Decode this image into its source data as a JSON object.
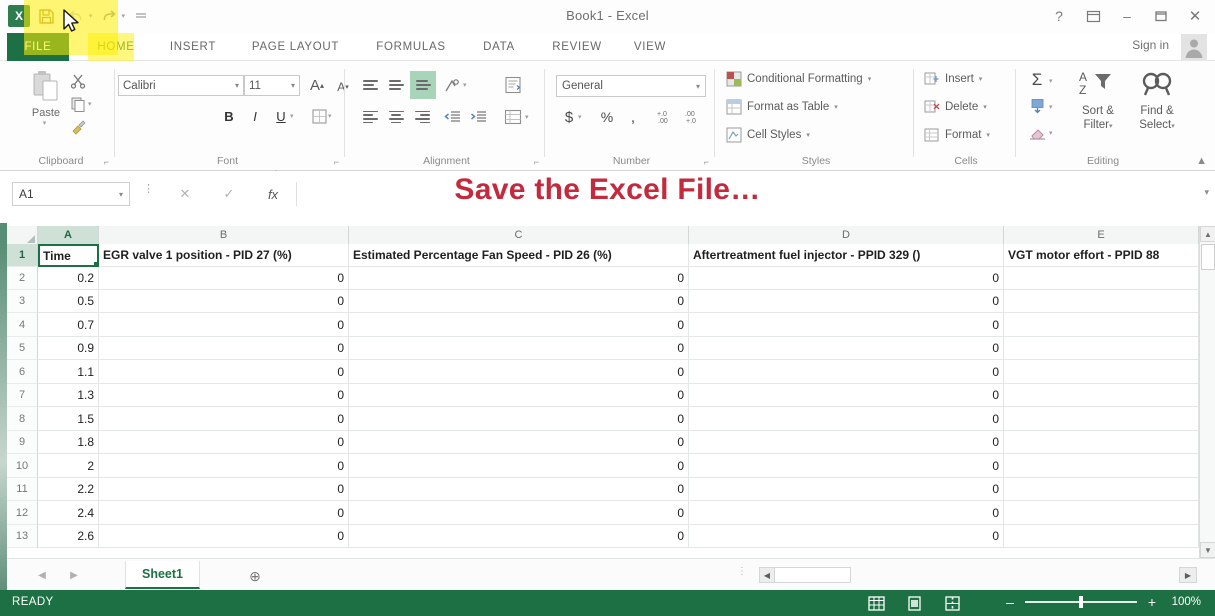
{
  "window": {
    "title": "Book1 - Excel",
    "sign_in": "Sign in",
    "buttons": {
      "help": "?",
      "ribbon_options": "ribbon-display-options",
      "minimize": "–",
      "maximize": "▢",
      "close": "✕"
    }
  },
  "quick_access": {
    "logo": "excel-logo",
    "items": [
      {
        "name": "save",
        "glyph": "save-icon"
      },
      {
        "name": "undo",
        "glyph": "undo-icon"
      },
      {
        "name": "redo",
        "glyph": "redo-icon"
      },
      {
        "name": "customize",
        "glyph": "customize-icon"
      }
    ]
  },
  "ribbon": {
    "tabs": [
      {
        "label": "FILE",
        "active": false
      },
      {
        "label": "HOME",
        "active": true
      },
      {
        "label": "INSERT",
        "active": false
      },
      {
        "label": "PAGE LAYOUT",
        "active": false
      },
      {
        "label": "FORMULAS",
        "active": false
      },
      {
        "label": "DATA",
        "active": false
      },
      {
        "label": "REVIEW",
        "active": false
      },
      {
        "label": "VIEW",
        "active": false
      }
    ],
    "collapse_glyph": "▲",
    "groups": {
      "clipboard": {
        "label": "Clipboard",
        "paste_label": "Paste",
        "cut": "cut-icon",
        "copy": "copy-icon",
        "format_painter": "format-painter-icon"
      },
      "font": {
        "label": "Font",
        "font_name": "Calibri",
        "font_size": "11",
        "grow_font": "A",
        "shrink_font": "A",
        "bold": "B",
        "italic": "I",
        "underline": "U",
        "borders": "borders-icon",
        "fill_color": "fill-color-icon",
        "font_color": "font-color-icon"
      },
      "alignment": {
        "label": "Alignment",
        "top_align": "top-align-icon",
        "middle_align": "middle-align-icon",
        "bottom_align": "bottom-align-icon",
        "orientation": "orientation-icon",
        "align_left": "align-left-icon",
        "align_center": "align-center-icon",
        "align_right": "align-right-icon",
        "decrease_indent": "decrease-indent-icon",
        "increase_indent": "increase-indent-icon",
        "wrap_text": "wrap-text-icon",
        "merge_center": "merge-center-icon"
      },
      "number": {
        "label": "Number",
        "format": "General",
        "currency": "$",
        "percent": "%",
        "comma": ",",
        "increase_decimal": "increase-decimal-icon",
        "decrease_decimal": "decrease-decimal-icon"
      },
      "styles": {
        "label": "Styles",
        "items": [
          "Conditional Formatting",
          "Format as Table",
          "Cell Styles"
        ]
      },
      "cells": {
        "label": "Cells",
        "items": [
          "Insert",
          "Delete",
          "Format"
        ]
      },
      "editing": {
        "label": "Editing",
        "autosum": "Σ",
        "fill": "fill-icon",
        "clear": "clear-icon",
        "sort_filter_line1": "Sort &",
        "sort_filter_line2": "Filter",
        "find_select_line1": "Find &",
        "find_select_line2": "Select"
      }
    }
  },
  "formula_bar": {
    "name_box": "A1",
    "cancel": "✕",
    "enter": "✓",
    "insert_function": "fx",
    "value": "",
    "expand": "▾"
  },
  "overlay": {
    "text": "Save the Excel File…",
    "color": "#c42a3d"
  },
  "grid": {
    "columns": [
      {
        "letter": "A",
        "selected": true
      },
      {
        "letter": "B",
        "selected": false
      },
      {
        "letter": "C",
        "selected": false
      },
      {
        "letter": "D",
        "selected": false
      },
      {
        "letter": "E",
        "selected": false
      }
    ],
    "headers": [
      "Time",
      "EGR valve 1 position - PID 27 (%)",
      "Estimated Percentage Fan Speed - PID 26 (%)",
      "Aftertreatment fuel injector - PPID 329 ()",
      "VGT motor effort - PPID 88"
    ],
    "selected_cell": "A1",
    "rows": [
      {
        "n": "1",
        "cells": [
          "Time",
          "EGR valve 1 position - PID 27 (%)",
          "Estimated Percentage Fan Speed - PID 26 (%)",
          "Aftertreatment fuel injector - PPID 329 ()",
          "VGT motor effort - PPID 88"
        ]
      },
      {
        "n": "2",
        "cells": [
          "0.2",
          "0",
          "0",
          "0",
          ""
        ]
      },
      {
        "n": "3",
        "cells": [
          "0.5",
          "0",
          "0",
          "0",
          ""
        ]
      },
      {
        "n": "4",
        "cells": [
          "0.7",
          "0",
          "0",
          "0",
          ""
        ]
      },
      {
        "n": "5",
        "cells": [
          "0.9",
          "0",
          "0",
          "0",
          ""
        ]
      },
      {
        "n": "6",
        "cells": [
          "1.1",
          "0",
          "0",
          "0",
          ""
        ]
      },
      {
        "n": "7",
        "cells": [
          "1.3",
          "0",
          "0",
          "0",
          ""
        ]
      },
      {
        "n": "8",
        "cells": [
          "1.5",
          "0",
          "0",
          "0",
          ""
        ]
      },
      {
        "n": "9",
        "cells": [
          "1.8",
          "0",
          "0",
          "0",
          ""
        ]
      },
      {
        "n": "10",
        "cells": [
          "2",
          "0",
          "0",
          "0",
          ""
        ]
      },
      {
        "n": "11",
        "cells": [
          "2.2",
          "0",
          "0",
          "0",
          ""
        ]
      },
      {
        "n": "12",
        "cells": [
          "2.4",
          "0",
          "0",
          "0",
          ""
        ]
      },
      {
        "n": "13",
        "cells": [
          "2.6",
          "0",
          "0",
          "0",
          ""
        ]
      }
    ]
  },
  "sheet_tabs": {
    "first": "◀",
    "prev": "▶",
    "active_sheet": "Sheet1",
    "add_sheet": "⊕"
  },
  "status_bar": {
    "mode": "READY",
    "views": [
      "normal-view",
      "page-layout-view",
      "page-break-view"
    ],
    "zoom_out": "–",
    "zoom_in": "+",
    "zoom_level": "100%",
    "accent_color": "#1d7044"
  }
}
